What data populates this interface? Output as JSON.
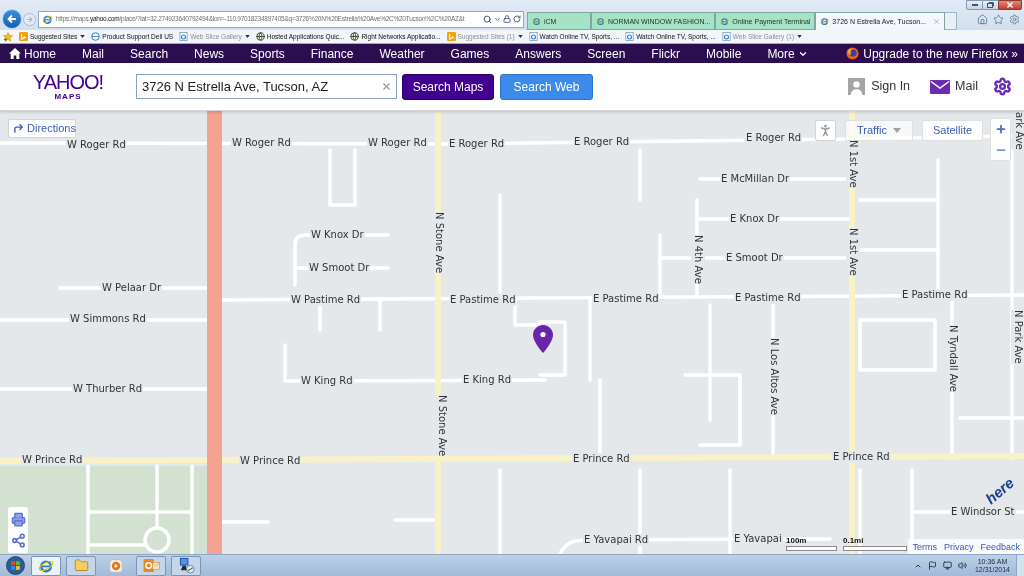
{
  "browser": {
    "address_bar": {
      "url": "https://maps.**yahoo.com**/place/?lat=32.274923640792494&lon=-110.97018234897405&q=3726%20N%20Estrella%20Ave%2C%20Tucson%2C%20AZ&t"
    },
    "tabs": [
      {
        "label": "iCM",
        "selected": false
      },
      {
        "label": "NORMAN WINDOW FASHION...",
        "selected": false
      },
      {
        "label": "Online Payment Terminal",
        "selected": false
      },
      {
        "label": "3726 N Estrella Ave, Tucson...",
        "selected": true
      }
    ],
    "favorites": [
      {
        "label": "Suggested Sites",
        "kind": "bing",
        "dropdown": true,
        "disabled": false
      },
      {
        "label": "Product Support Dell US",
        "kind": "ring",
        "dropdown": false,
        "disabled": false
      },
      {
        "label": "Web Slice Gallery",
        "kind": "page",
        "dropdown": true,
        "disabled": true
      },
      {
        "label": "Hosted Applications Quic...",
        "kind": "globe",
        "dropdown": false,
        "disabled": false
      },
      {
        "label": "Right Networks Applicatio...",
        "kind": "globe",
        "dropdown": false,
        "disabled": false
      },
      {
        "label": "Suggested Sites (1)",
        "kind": "bing",
        "dropdown": true,
        "disabled": true
      },
      {
        "label": "Watch Online TV, Sports, ...",
        "kind": "page",
        "dropdown": false,
        "disabled": false
      },
      {
        "label": "Watch Online TV, Sports, ...",
        "kind": "page",
        "dropdown": false,
        "disabled": false
      },
      {
        "label": "Web Slice Gallery (1)",
        "kind": "page",
        "dropdown": true,
        "disabled": true
      }
    ]
  },
  "nav_bar": {
    "items": [
      {
        "label": "Home",
        "kind": "home"
      },
      {
        "label": "Mail",
        "kind": "link"
      },
      {
        "label": "Search",
        "kind": "link"
      },
      {
        "label": "News",
        "kind": "link"
      },
      {
        "label": "Sports",
        "kind": "link"
      },
      {
        "label": "Finance",
        "kind": "link"
      },
      {
        "label": "Weather",
        "kind": "link"
      },
      {
        "label": "Games",
        "kind": "link"
      },
      {
        "label": "Answers",
        "kind": "link"
      },
      {
        "label": "Screen",
        "kind": "link"
      },
      {
        "label": "Flickr",
        "kind": "link"
      },
      {
        "label": "Mobile",
        "kind": "link"
      },
      {
        "label": "More",
        "kind": "menu"
      }
    ],
    "promo": "Upgrade to the new Firefox »"
  },
  "header": {
    "logo": {
      "wordmark": "YAHOO!",
      "product": "MAPS"
    },
    "search": {
      "value": "3726 N Estrella Ave, Tucson, AZ"
    },
    "buttons": [
      {
        "label": "Search Maps",
        "kind": "primary"
      },
      {
        "label": "Search Web",
        "kind": "secondary"
      }
    ],
    "account": [
      {
        "label": "Sign In",
        "kind": "user"
      },
      {
        "label": "Mail",
        "kind": "mail"
      }
    ]
  },
  "map": {
    "controls": {
      "directions": "Directions",
      "traffic": "Traffic",
      "satellite": "Satellite"
    },
    "labels": [
      {
        "text": "W Roger Rd",
        "vertical": false
      },
      {
        "text": "W Roger Rd",
        "vertical": false
      },
      {
        "text": "W Roger Rd",
        "vertical": false
      },
      {
        "text": "E Roger Rd",
        "vertical": false
      },
      {
        "text": "E Roger Rd",
        "vertical": false
      },
      {
        "text": "E Roger Rd",
        "vertical": false
      },
      {
        "text": "N 1st Ave",
        "vertical": true
      },
      {
        "text": "ark Ave",
        "vertical": true
      },
      {
        "text": "E McMillan Dr",
        "vertical": false
      },
      {
        "text": "N Stone Ave",
        "vertical": true
      },
      {
        "text": "E Knox Dr",
        "vertical": false
      },
      {
        "text": "W Knox Dr",
        "vertical": false
      },
      {
        "text": "N 1st Ave",
        "vertical": true
      },
      {
        "text": "N 4th Ave",
        "vertical": true
      },
      {
        "text": "E Smoot Dr",
        "vertical": false
      },
      {
        "text": "W Smoot Dr",
        "vertical": false
      },
      {
        "text": "W Pelaar Dr",
        "vertical": false
      },
      {
        "text": "W Pastime Rd",
        "vertical": false
      },
      {
        "text": "E Pastime Rd",
        "vertical": false
      },
      {
        "text": "E Pastime Rd",
        "vertical": false
      },
      {
        "text": "E Pastime Rd",
        "vertical": false
      },
      {
        "text": "E Pastime Rd",
        "vertical": false
      },
      {
        "text": "W Simmons Rd",
        "vertical": false
      },
      {
        "text": "N Park Ave",
        "vertical": true
      },
      {
        "text": "N Tyndall Ave",
        "vertical": true
      },
      {
        "text": "N Los Altos Ave",
        "vertical": true
      },
      {
        "text": "W Thurber Rd",
        "vertical": false
      },
      {
        "text": "W King Rd",
        "vertical": false
      },
      {
        "text": "E King Rd",
        "vertical": false
      },
      {
        "text": "N Stone Ave",
        "vertical": true
      },
      {
        "text": "W Prince Rd",
        "vertical": false
      },
      {
        "text": "W Prince Rd",
        "vertical": false
      },
      {
        "text": "E Prince Rd",
        "vertical": false
      },
      {
        "text": "E Prince Rd",
        "vertical": false
      },
      {
        "text": "E Windsor St",
        "vertical": false
      },
      {
        "text": "E Yavapai Rd",
        "vertical": false
      },
      {
        "text": "E Yavapai",
        "vertical": false
      }
    ],
    "scale": {
      "metric": "100m",
      "imperial": "0.1mi"
    },
    "provider": "here",
    "links": [
      "Terms",
      "Privacy",
      "Feedback"
    ]
  },
  "taskbar": {
    "apps": [
      {
        "kind": "ie",
        "running": true,
        "selected": true
      },
      {
        "kind": "folder",
        "running": true,
        "selected": false
      },
      {
        "kind": "media",
        "running": false,
        "selected": false
      },
      {
        "kind": "outlook",
        "running": true,
        "selected": false
      },
      {
        "kind": "remote",
        "running": true,
        "selected": false
      }
    ],
    "clock": {
      "time": "10:36 AM",
      "date": "12/31/2014"
    }
  }
}
